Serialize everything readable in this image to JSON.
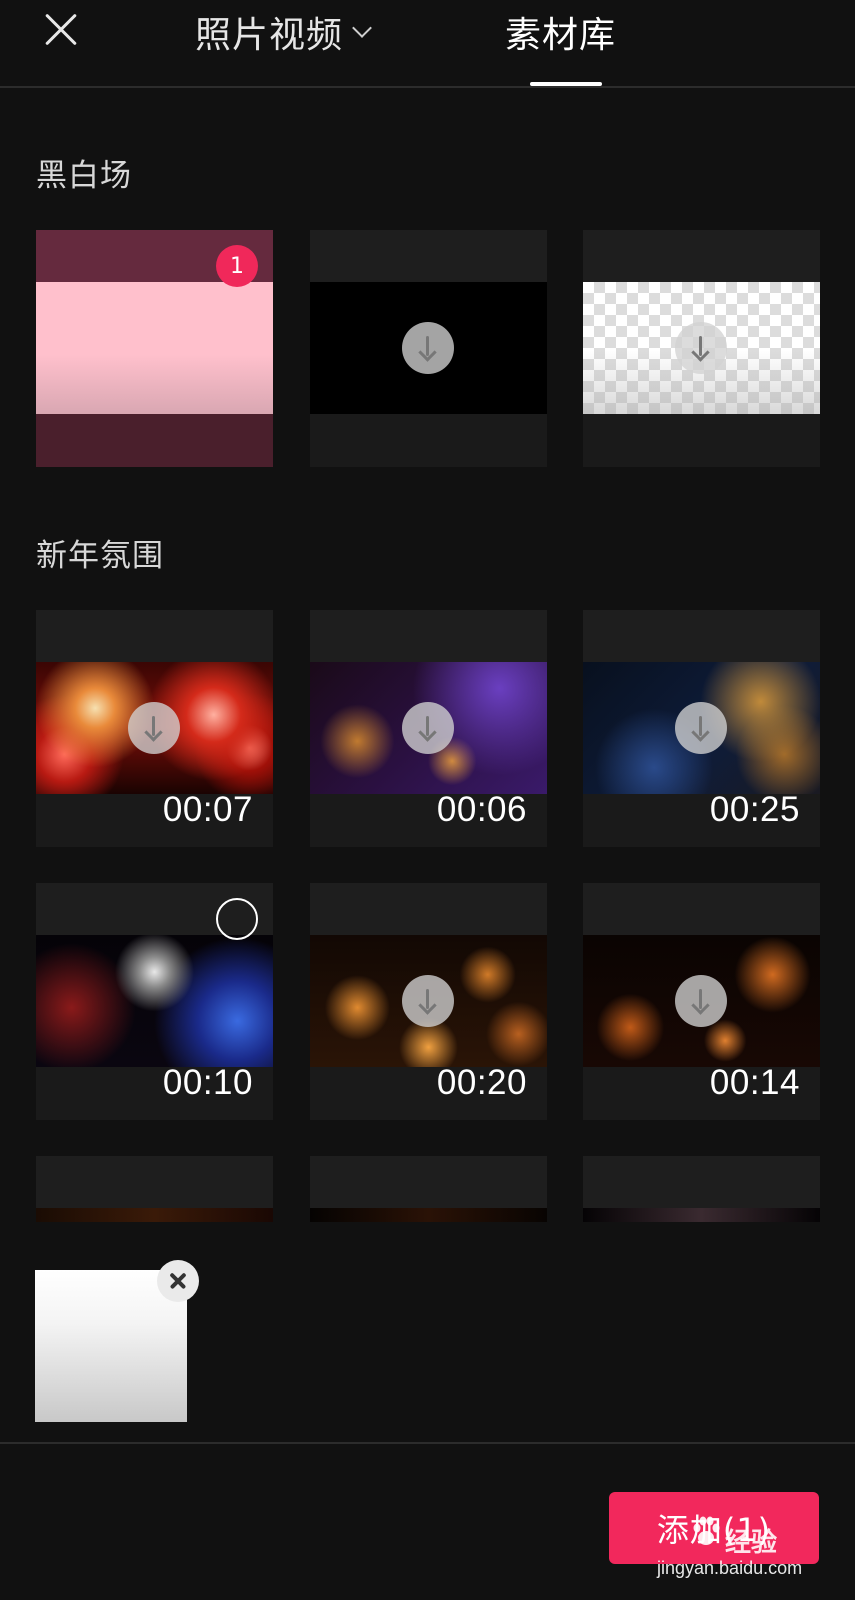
{
  "header": {
    "tab_photo_label": "照片视频",
    "tab_library_label": "素材库",
    "active_tab": "素材库"
  },
  "sections": [
    {
      "title": "黑白场",
      "items": [
        {
          "name": "pink-clip",
          "selected_index": "1",
          "downloaded": true
        },
        {
          "name": "black-clip",
          "downloadable": true
        },
        {
          "name": "transparent-clip",
          "downloadable": true
        }
      ]
    },
    {
      "title": "新年氛围",
      "items": [
        {
          "name": "red-fireworks",
          "duration": "00:07",
          "downloadable": true
        },
        {
          "name": "purple-sparkle",
          "duration": "00:06",
          "downloadable": true
        },
        {
          "name": "blue-gold-glitter",
          "duration": "00:25",
          "downloadable": true
        },
        {
          "name": "blue-fireworks",
          "duration": "00:10",
          "downloaded": true,
          "selected": false
        },
        {
          "name": "bokeh-lights",
          "duration": "00:20",
          "downloadable": true
        },
        {
          "name": "sparks",
          "duration": "00:14",
          "downloadable": true
        }
      ]
    }
  ],
  "tray": {
    "selected_count": 1
  },
  "footer": {
    "add_button_label": "添加(1)"
  },
  "watermark": {
    "main": "经验",
    "sub": "jingyan.baidu.com"
  },
  "colors": {
    "background": "#111111",
    "accent": "#f2285c",
    "badge": "#f0285a"
  }
}
